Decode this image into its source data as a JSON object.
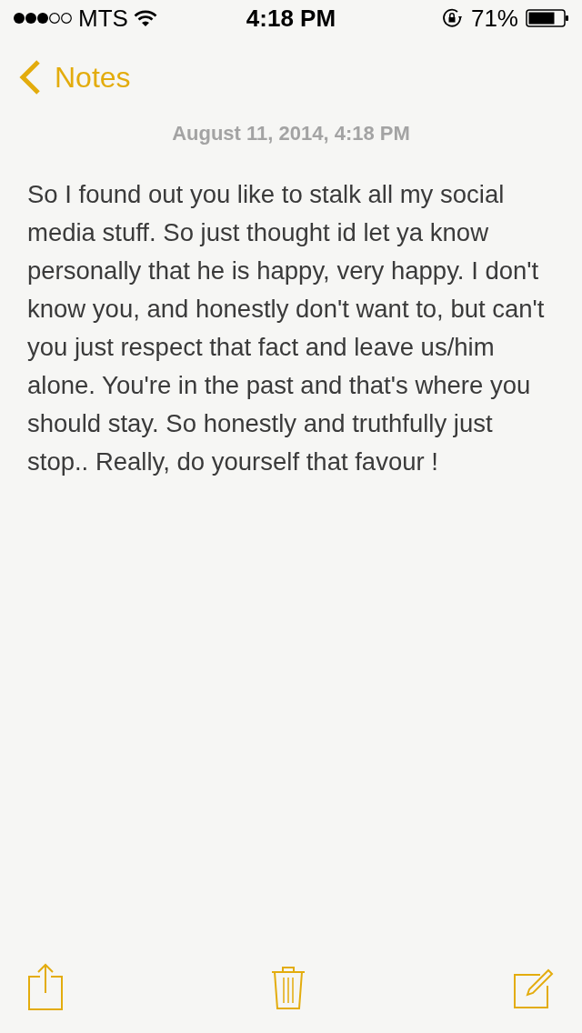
{
  "status_bar": {
    "carrier": "MTS",
    "time": "4:18 PM",
    "battery_percent": "71%"
  },
  "nav": {
    "back_label": "Notes"
  },
  "note": {
    "date": "August 11, 2014, 4:18 PM",
    "body": "So I found out you like to stalk all my social media stuff. So just thought id let ya know personally that he is happy, very happy. I don't know you, and honestly don't want to, but can't you just respect that fact and leave us/him alone. You're in the past and that's where you should stay. So honestly and truthfully just stop.. Really, do yourself that favour !"
  }
}
